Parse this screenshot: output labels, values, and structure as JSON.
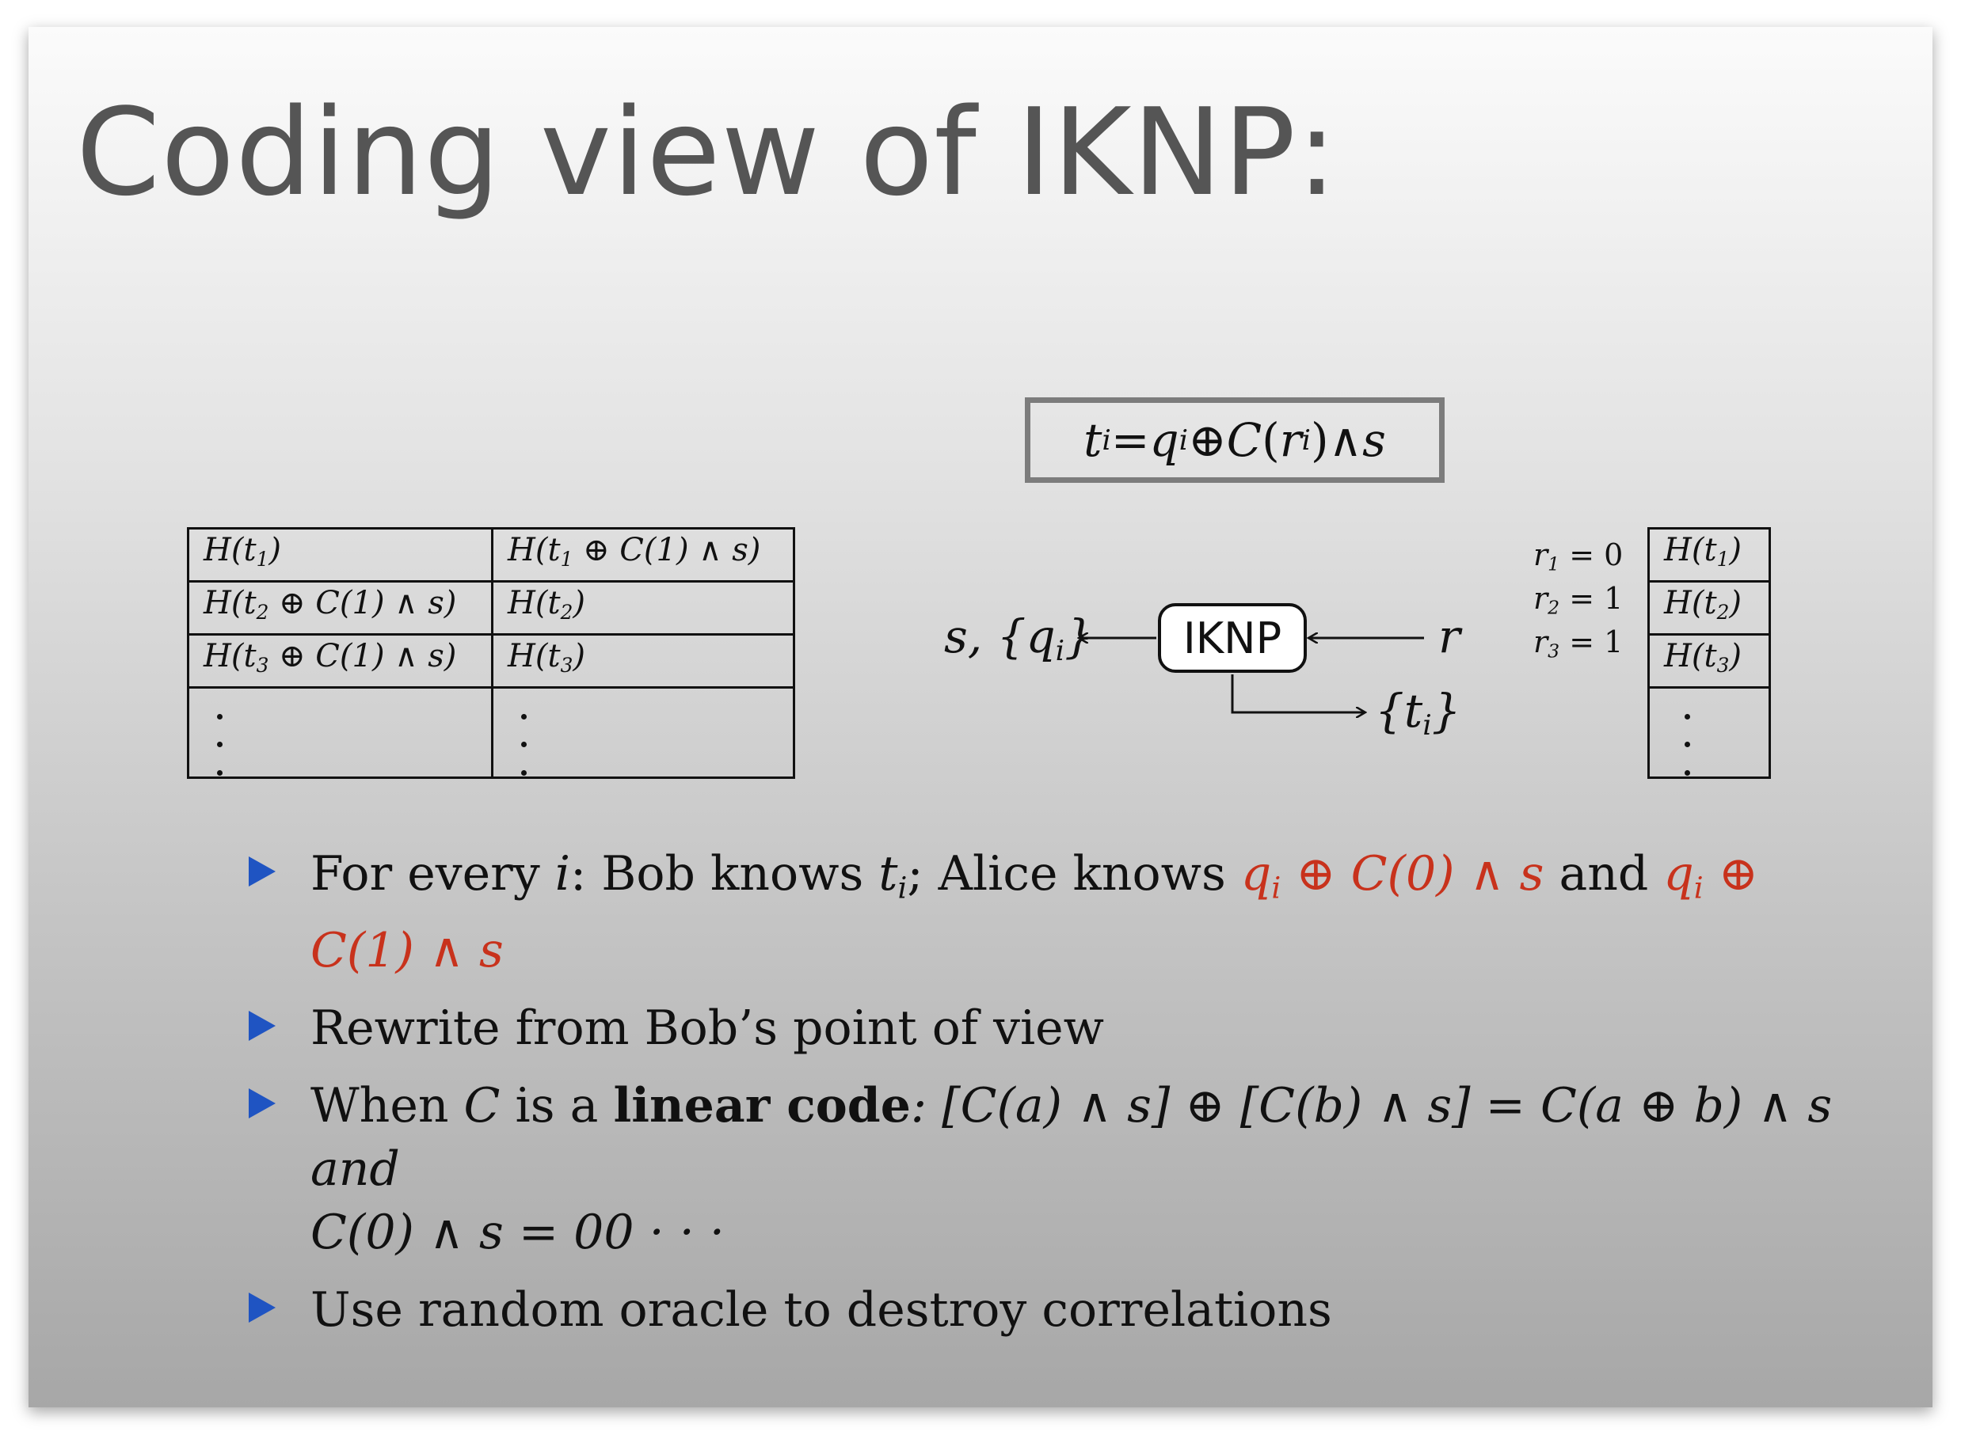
{
  "slide": {
    "title": "Coding view of IKNP:",
    "equation": {
      "t": "t",
      "i": "i",
      "eq": " = ",
      "q": "q",
      "op1": " ⊕ ",
      "c": "C",
      "open": "(",
      "r": "r",
      "close": ")",
      "and": " ∧ ",
      "s": "s"
    }
  },
  "left_table": {
    "rows": [
      [
        {
          "pre": "H(t",
          "sub": "1",
          "post": ")"
        },
        {
          "pre": "H(t",
          "sub": "1",
          "post": " ⊕ C(1) ∧ s)"
        }
      ],
      [
        {
          "pre": "H(t",
          "sub": "2",
          "post": " ⊕ C(1) ∧ s)"
        },
        {
          "pre": "H(t",
          "sub": "2",
          "post": ")"
        }
      ],
      [
        {
          "pre": "H(t",
          "sub": "3",
          "post": " ⊕ C(1) ∧ s)"
        },
        {
          "pre": "H(t",
          "sub": "3",
          "post": ")"
        }
      ]
    ]
  },
  "diagram": {
    "box_label": "IKNP",
    "left_output": {
      "pre": "s, {q",
      "sub": "i",
      "post": "}"
    },
    "right_input": "r",
    "bottom_output": {
      "pre": "{t",
      "sub": "i",
      "post": "}"
    }
  },
  "right_table": {
    "r_labels": [
      {
        "pre": "r",
        "sub": "1",
        "post": " = 0"
      },
      {
        "pre": "r",
        "sub": "2",
        "post": " = 1"
      },
      {
        "pre": "r",
        "sub": "3",
        "post": " = 1"
      }
    ],
    "rows": [
      {
        "pre": "H(t",
        "sub": "1",
        "post": ")"
      },
      {
        "pre": "H(t",
        "sub": "2",
        "post": ")"
      },
      {
        "pre": "H(t",
        "sub": "3",
        "post": ")"
      }
    ]
  },
  "bullets": {
    "b1": {
      "a": "For every ",
      "i": "i",
      "b": ": Bob knows ",
      "t": "t",
      "ti": "i",
      "c": "; Alice knows ",
      "r1q": "q",
      "r1i": "i",
      "r1rest": " ⊕ C(0) ∧ s",
      "d": " and ",
      "r2q": "q",
      "r2i": "i",
      "r2rest": " ⊕ C(1) ∧ s"
    },
    "b2": "Rewrite from Bob’s point of view",
    "b3": {
      "a": "When ",
      "c": "C",
      "b": " is a ",
      "bold": "linear code",
      "rest": ": [C(a) ∧ s] ⊕ [C(b) ∧ s] = C(a ⊕ b) ∧ s  and",
      "line2": "C(0) ∧ s = 00 · · ·"
    },
    "b4": "Use random oracle to destroy correlations"
  },
  "colors": {
    "bullet": "#1f54c2",
    "highlight": "#c8321c",
    "title": "#555555"
  }
}
